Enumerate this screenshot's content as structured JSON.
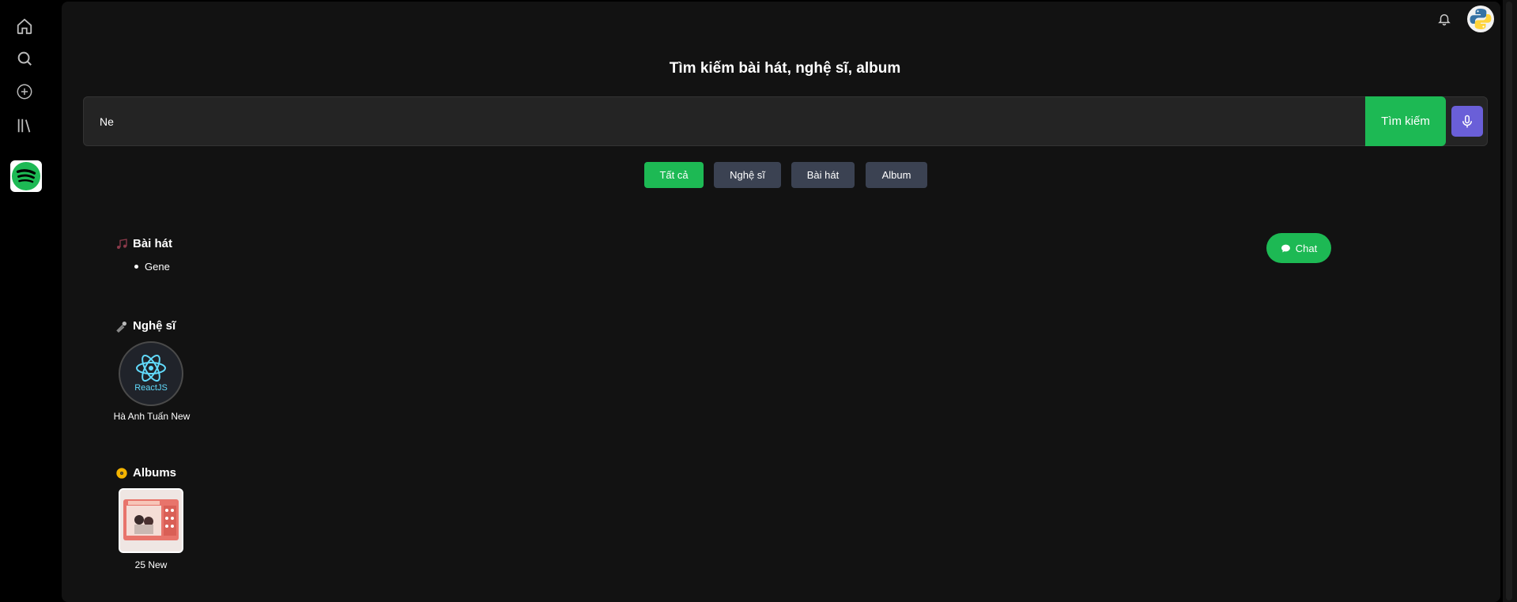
{
  "sidebar": {
    "icons": [
      "home-icon",
      "search-icon",
      "add-icon",
      "library-icon",
      "spotify-logo"
    ]
  },
  "header": {
    "bell": "bell-icon",
    "avatar": "python-logo"
  },
  "page": {
    "title": "Tìm kiếm bài hát, nghệ sĩ, album"
  },
  "search": {
    "value": "Ne",
    "button_label": "Tìm kiếm",
    "mic": "microphone-icon"
  },
  "filters": [
    {
      "label": "Tất cả",
      "active": true
    },
    {
      "label": "Nghệ sĩ",
      "active": false
    },
    {
      "label": "Bài hát",
      "active": false
    },
    {
      "label": "Album",
      "active": false
    }
  ],
  "songs": {
    "title": "Bài hát",
    "icon": "music-note-icon",
    "items": [
      "Gene"
    ]
  },
  "artists": {
    "title": "Nghệ sĩ",
    "icon": "microphone-icon",
    "items": [
      {
        "name": "Hà Anh Tuấn New",
        "image_text": "ReactJS"
      }
    ]
  },
  "albums": {
    "title": "Albums",
    "icon": "disc-icon",
    "items": [
      {
        "name": "25 New"
      }
    ]
  },
  "chat": {
    "label": "Chat",
    "icon": "chat-bubble-icon"
  },
  "colors": {
    "accent": "#1db954",
    "mic": "#6a5fd8",
    "filter_inactive": "#3b4252",
    "surface": "#121212"
  }
}
